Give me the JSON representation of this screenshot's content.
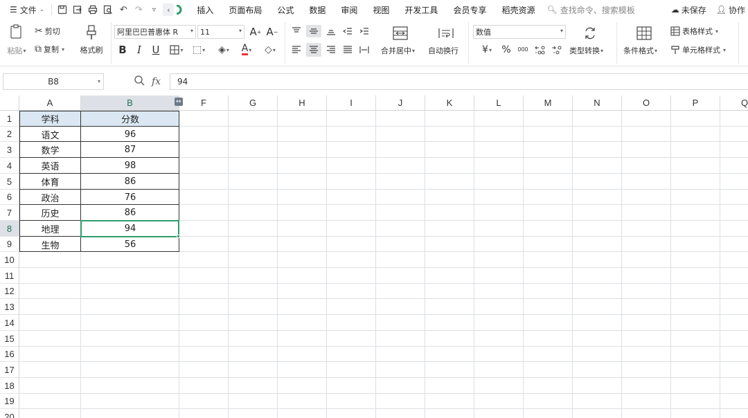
{
  "menubar": {
    "file_label": "文件",
    "tabs": [
      "插入",
      "页面布局",
      "公式",
      "数据",
      "审阅",
      "视图",
      "开发工具",
      "会员专享",
      "稻壳资源"
    ],
    "search_placeholder": "查找命令、搜索模板",
    "unsaved_label": "未保存",
    "collab_label": "协作"
  },
  "ribbon": {
    "paste_label": "粘贴",
    "cut_label": "剪切",
    "copy_label": "复制",
    "format_painter_label": "格式刷",
    "font_name": "阿里巴巴普惠体 R",
    "font_size": "11",
    "merge_center_label": "合并居中",
    "wrap_text_label": "自动换行",
    "number_format": "数值",
    "currency_symbol": "¥",
    "percent_symbol": "%",
    "type_convert_label": "类型转换",
    "cond_format_label": "条件格式",
    "table_style_label": "表格样式",
    "cell_style_label": "单元格样式"
  },
  "formula_bar": {
    "name_box": "B8",
    "fx": "fx",
    "value": "94"
  },
  "sheet": {
    "columns": [
      "A",
      "B",
      "F",
      "G",
      "H",
      "I",
      "J",
      "K",
      "L",
      "M",
      "N",
      "O",
      "P",
      "Q"
    ],
    "rows": [
      "1",
      "2",
      "3",
      "4",
      "5",
      "6",
      "7",
      "8",
      "9",
      "10",
      "11",
      "12",
      "13",
      "14",
      "15",
      "16",
      "17",
      "18",
      "19",
      "20"
    ],
    "selected_cell": "B8",
    "header": [
      "学科",
      "分数"
    ],
    "data": [
      [
        "语文",
        "96"
      ],
      [
        "数学",
        "87"
      ],
      [
        "英语",
        "98"
      ],
      [
        "体育",
        "86"
      ],
      [
        "政治",
        "76"
      ],
      [
        "历史",
        "86"
      ],
      [
        "地理",
        "94"
      ],
      [
        "生物",
        "56"
      ]
    ],
    "colors": {
      "selection": "#2e9c6c",
      "header_fill": "#dbe8f4",
      "selected_header": "#dde1e7"
    }
  }
}
